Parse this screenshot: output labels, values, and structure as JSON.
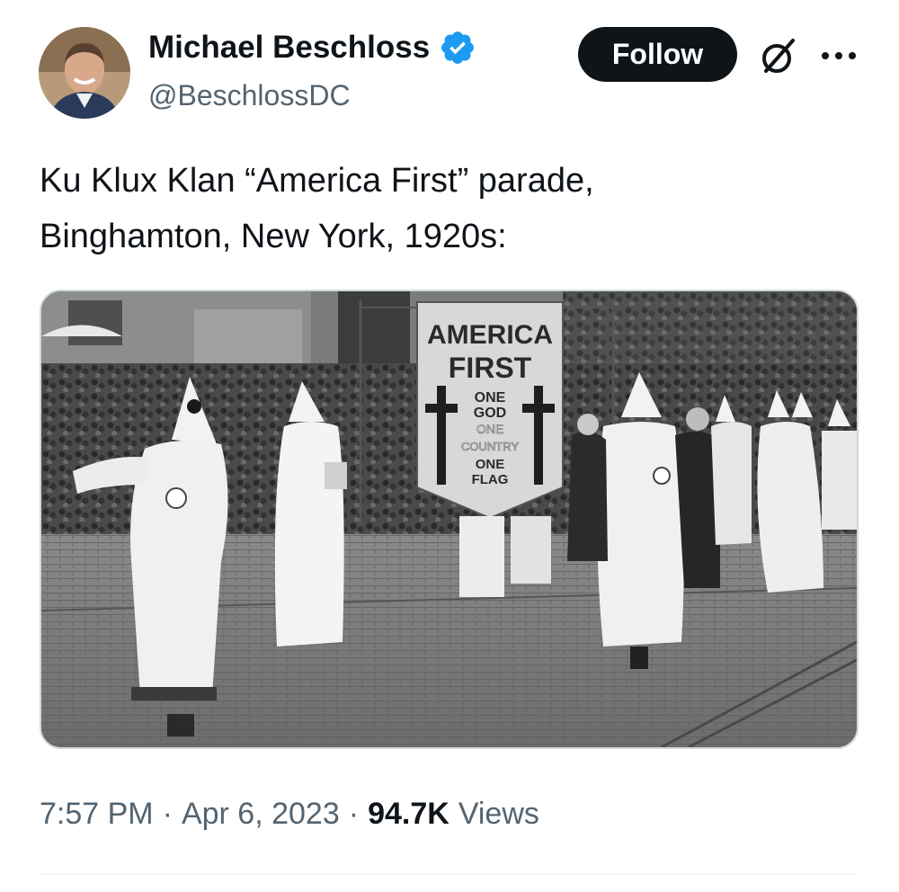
{
  "author": {
    "display_name": "Michael Beschloss",
    "handle": "@BeschlossDC",
    "verified": true,
    "avatar_icon": "profile-photo"
  },
  "actions": {
    "follow_label": "Follow",
    "grok_icon": "grok-icon",
    "more_icon": "more-dots-icon"
  },
  "tweet": {
    "text_line1": "Ku Klux Klan “America First” parade,",
    "text_line2": "Binghamton, New York, 1920s:"
  },
  "media": {
    "banner": {
      "line1": "AMERICA",
      "line2": "FIRST",
      "line3": "ONE",
      "line4": "GOD",
      "line5": "ONE",
      "line6": "COUNTRY",
      "line7": "ONE",
      "line8": "FLAG"
    }
  },
  "meta": {
    "time": "7:57 PM",
    "separator": "·",
    "date": "Apr 6, 2023",
    "views_count": "94.7K",
    "views_label": "Views"
  },
  "colors": {
    "text_primary": "#0f1419",
    "text_secondary": "#536471",
    "verified_blue": "#1d9bf0",
    "border": "#cfd9de"
  }
}
